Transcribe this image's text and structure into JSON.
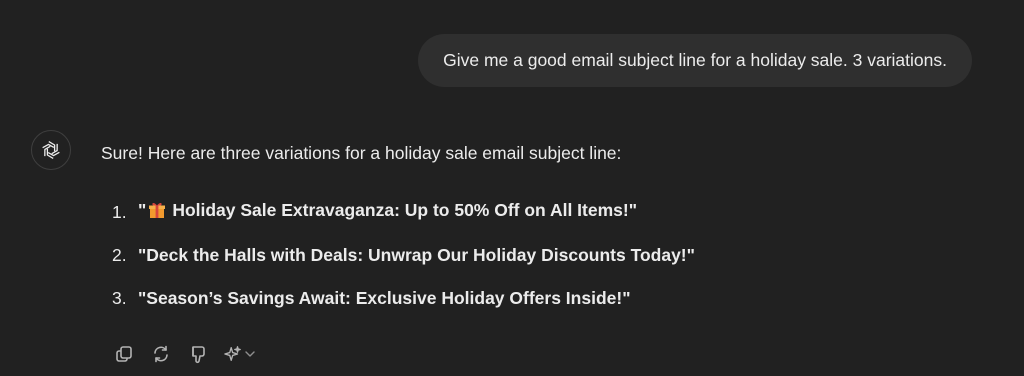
{
  "user_message": {
    "text": "Give me a good email subject line for a holiday sale. 3 variations."
  },
  "assistant": {
    "avatar_icon": "openai-logo-icon",
    "intro": "Sure! Here are three variations for a holiday sale email subject line:",
    "items": [
      {
        "number": "1.",
        "quote_open": "\"",
        "emoji": "gift-icon",
        "text": "Holiday Sale Extravaganza: Up to 50% Off on All Items!\""
      },
      {
        "number": "2.",
        "text": "\"Deck the Halls with Deals: Unwrap Our Holiday Discounts Today!\""
      },
      {
        "number": "3.",
        "text": "\"Season’s Savings Await: Exclusive Holiday Offers Inside!\""
      }
    ]
  },
  "actions": [
    {
      "icon": "copy-icon"
    },
    {
      "icon": "regenerate-icon"
    },
    {
      "icon": "thumbs-down-icon"
    },
    {
      "icon": "sparkle-icon"
    }
  ],
  "colors": {
    "background": "#212121",
    "user_bubble": "#2f2f2f",
    "text": "#ececec",
    "icon": "#b4b4b4",
    "gift_box": "#f29a2e",
    "gift_ribbon": "#d6453d"
  }
}
